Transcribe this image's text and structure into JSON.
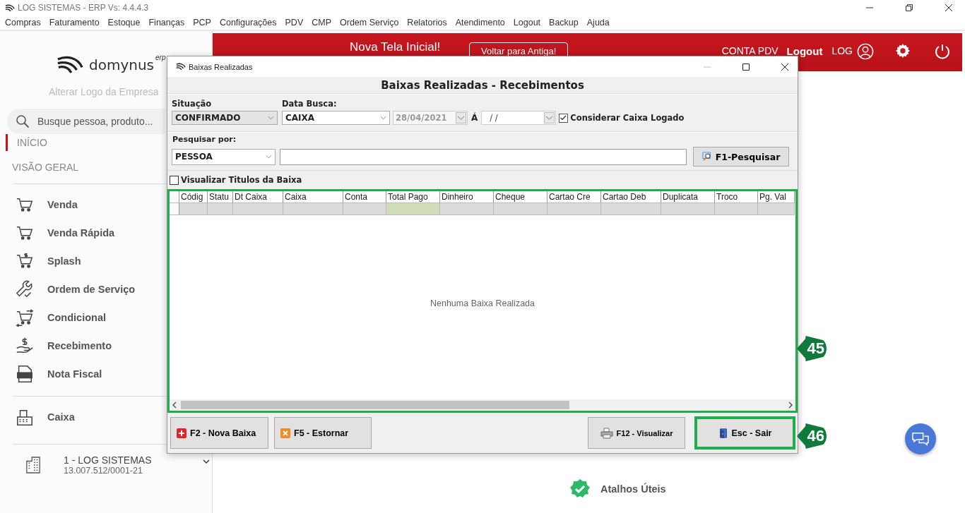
{
  "app_window": {
    "title": "LOG SISTEMAS - ERP Vs: 4.4.4.3"
  },
  "menu": [
    "Compras",
    "Faturamento",
    "Estoque",
    "Finanças",
    "PCP",
    "Configurações",
    "PDV",
    "CMP",
    "Ordem Serviço",
    "Relatorios",
    "Atendimento",
    "Logout",
    "Backup",
    "Ajuda"
  ],
  "sidebar": {
    "logo_text": "domynus",
    "logo_suffix": "erp",
    "change_logo_link": "Alterar Logo da Empresa",
    "search": {
      "placeholder": "Busque pessoa, produto..."
    },
    "sections": [
      {
        "label": "INÍCIO",
        "selected": true
      },
      {
        "label": "VISÃO GERAL",
        "selected": false
      }
    ],
    "items": [
      {
        "label": "Venda",
        "kind": "cart"
      },
      {
        "label": "Venda Rápida",
        "kind": "cart"
      },
      {
        "label": "Splash",
        "kind": "cart-dollar"
      },
      {
        "label": "Ordem de Serviço",
        "kind": "wrench"
      },
      {
        "label": "Condicional",
        "kind": "cart-swap"
      },
      {
        "label": "Recebimento",
        "kind": "hand-dollar"
      },
      {
        "label": "Nota Fiscal",
        "kind": "nfe"
      }
    ],
    "items2": [
      {
        "label": "Caixa",
        "kind": "register"
      }
    ],
    "company": {
      "name": "1 - LOG SISTEMAS",
      "cnpj": "13.007.512/0001-21"
    }
  },
  "header": {
    "title": "Nova Tela Inicial!",
    "back_button": "Voltar para Antiga!",
    "account": "CONTA PDV",
    "logout": "Logout",
    "user": "LOG"
  },
  "shortcuts": {
    "label": "Atalhos Úteis"
  },
  "dialog": {
    "title": "Baixas Realizadas",
    "heading": "Baixas Realizadas - Recebimentos",
    "situacao": {
      "label": "Situação",
      "value": "CONFIRMADO"
    },
    "data_busca": {
      "label": "Data Busca:",
      "value": "CAIXA",
      "date_from": "28/04/2021",
      "separator": "Á",
      "date_to": "/  /"
    },
    "consider_logged": {
      "label": "Considerar Caixa Logado",
      "checked": true
    },
    "search_by": {
      "label": "Pesquisar por:",
      "value": "PESSOA",
      "button": "F1-Pesquisar"
    },
    "view_titles": {
      "label": "Visualizar Titulos da Baixa",
      "checked": false
    },
    "table": {
      "highlighted": true,
      "columns": [
        {
          "label": "Códig",
          "selected": false
        },
        {
          "label": "Statu",
          "selected": false
        },
        {
          "label": "Dt Caixa",
          "selected": false
        },
        {
          "label": "Caixa",
          "selected": false
        },
        {
          "label": "Conta",
          "selected": false
        },
        {
          "label": "Total Pago",
          "selected": true
        },
        {
          "label": "Dinheiro",
          "selected": false
        },
        {
          "label": "Cheque",
          "selected": false
        },
        {
          "label": "Cartao Cre",
          "selected": false
        },
        {
          "label": "Cartao Deb",
          "selected": false
        },
        {
          "label": "Duplicata",
          "selected": false
        },
        {
          "label": "Troco",
          "selected": false
        },
        {
          "label": "Pg. Val",
          "selected": false
        }
      ],
      "empty_message": "Nenhuma Baixa Realizada"
    },
    "buttons": [
      {
        "label": "F2 - Nova Baixa",
        "kind": "plus",
        "highlighted": false
      },
      {
        "label": "F5 - Estornar",
        "kind": "cancel",
        "highlighted": false
      },
      {
        "label": "F12 - Visualizar",
        "kind": "printer",
        "highlighted": false
      },
      {
        "label": "Esc - Sair",
        "kind": "door",
        "highlighted": true
      }
    ]
  },
  "callouts": [
    {
      "label": "45"
    },
    {
      "label": "46"
    }
  ]
}
